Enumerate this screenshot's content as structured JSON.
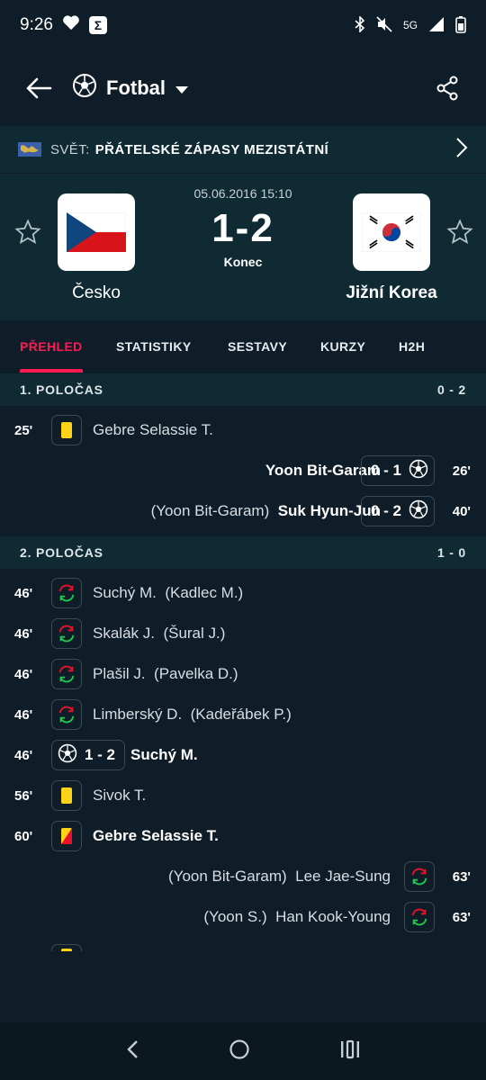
{
  "status": {
    "time": "9:26",
    "network": "5G"
  },
  "appbar": {
    "sport": "Fotbal"
  },
  "league": {
    "country": "SVĚT:",
    "name": "PŘÁTELSKÉ ZÁPASY MEZISTÁTNÍ"
  },
  "match": {
    "date": "05.06.2016 15:10",
    "score": "1-2",
    "status": "Konec",
    "home": "Česko",
    "away": "Jižní Korea"
  },
  "tabs": [
    "PŘEHLED",
    "STATISTIKY",
    "SESTAVY",
    "KURZY",
    "H2H"
  ],
  "half1": {
    "title": "1. POLOČAS",
    "score": "0 - 2",
    "events": [
      {
        "min": "25'",
        "player": "Gebre Selassie T."
      },
      {
        "min": "26'",
        "player": "Yoon Bit-Garam",
        "score": "0 - 1"
      },
      {
        "min": "40'",
        "player": "Suk Hyun-Jun",
        "assist": "(Yoon Bit-Garam)",
        "score": "0 - 2"
      }
    ]
  },
  "half2": {
    "title": "2. POLOČAS",
    "score": "1 - 0",
    "events": [
      {
        "min": "46'",
        "player": "Suchý M.",
        "other": "(Kadlec M.)"
      },
      {
        "min": "46'",
        "player": "Skalák J.",
        "other": "(Šural J.)"
      },
      {
        "min": "46'",
        "player": "Plašil J.",
        "other": "(Pavelka D.)"
      },
      {
        "min": "46'",
        "player": "Limberský D.",
        "other": "(Kadeřábek P.)"
      },
      {
        "min": "46'",
        "player": "Suchý M.",
        "score": "1 - 2"
      },
      {
        "min": "56'",
        "player": "Sivok T."
      },
      {
        "min": "60'",
        "player": "Gebre Selassie T."
      },
      {
        "min": "63'",
        "player": "Lee Jae-Sung",
        "other": "(Yoon Bit-Garam)"
      },
      {
        "min": "63'",
        "player": "Han Kook-Young",
        "other": "(Yoon S.)"
      }
    ]
  },
  "colors": {
    "accent": "#ff1a52",
    "background": "#0e1d28",
    "panel": "#0f2a33",
    "yellow": "#ffd21a",
    "red": "#e8132b"
  }
}
